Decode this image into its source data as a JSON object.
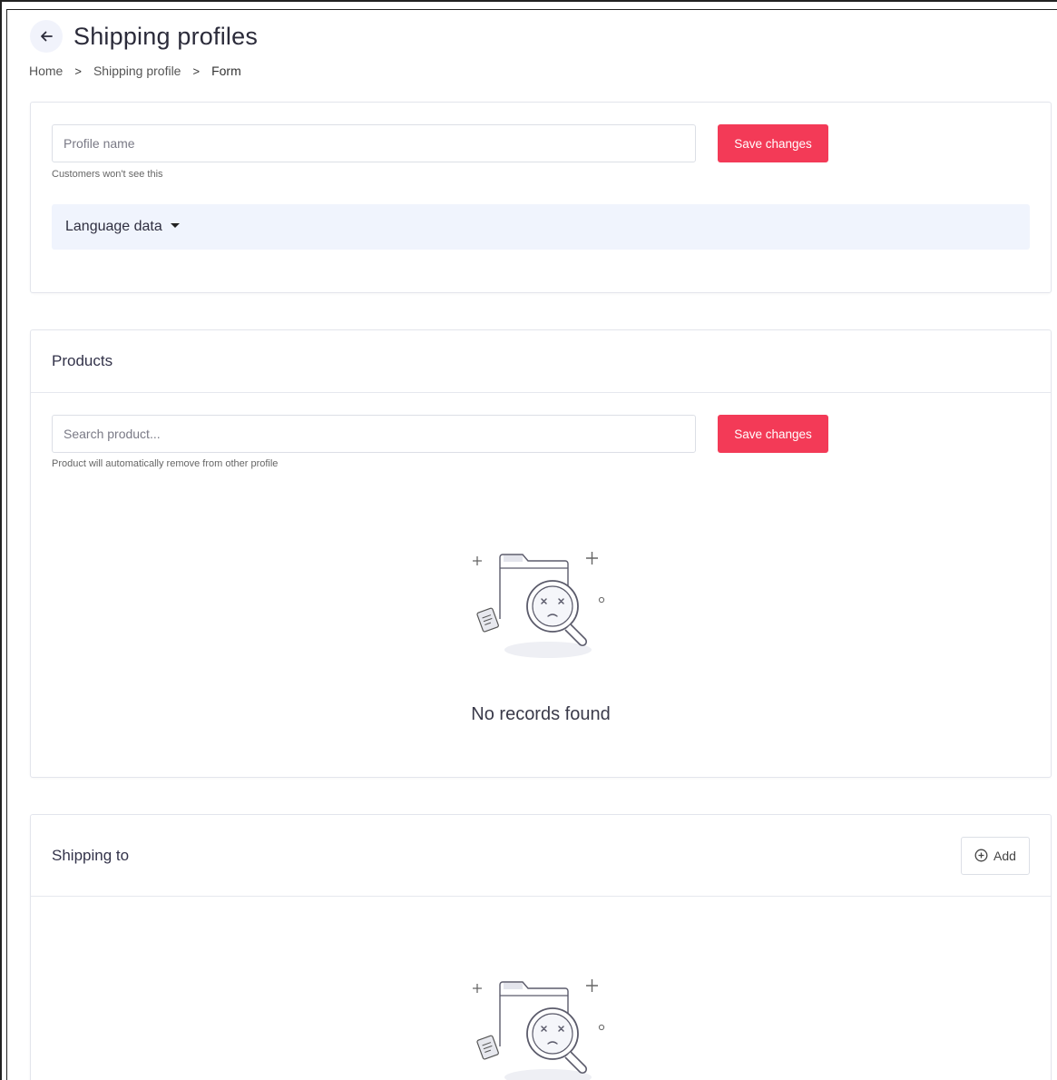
{
  "header": {
    "title": "Shipping profiles",
    "back_icon": "arrow-left-icon"
  },
  "breadcrumb": {
    "items": [
      "Home",
      "Shipping profile",
      "Form"
    ],
    "separator": ">"
  },
  "profile_card": {
    "name_placeholder": "Profile name",
    "name_value": "",
    "save_label": "Save changes",
    "hint": "Customers won't see this",
    "language_label": "Language data"
  },
  "products_card": {
    "title": "Products",
    "search_placeholder": "Search product...",
    "search_value": "",
    "save_label": "Save changes",
    "hint": "Product will automatically remove from other profile",
    "empty_text": "No records found",
    "empty_icon": "no-records-illustration"
  },
  "shipping_card": {
    "title": "Shipping to",
    "add_label": "Add",
    "add_icon": "plus-circle-icon",
    "empty_icon": "no-records-illustration"
  },
  "colors": {
    "accent": "#f33a57",
    "language_bar": "#f0f4fd",
    "border": "#e3e5ec"
  }
}
